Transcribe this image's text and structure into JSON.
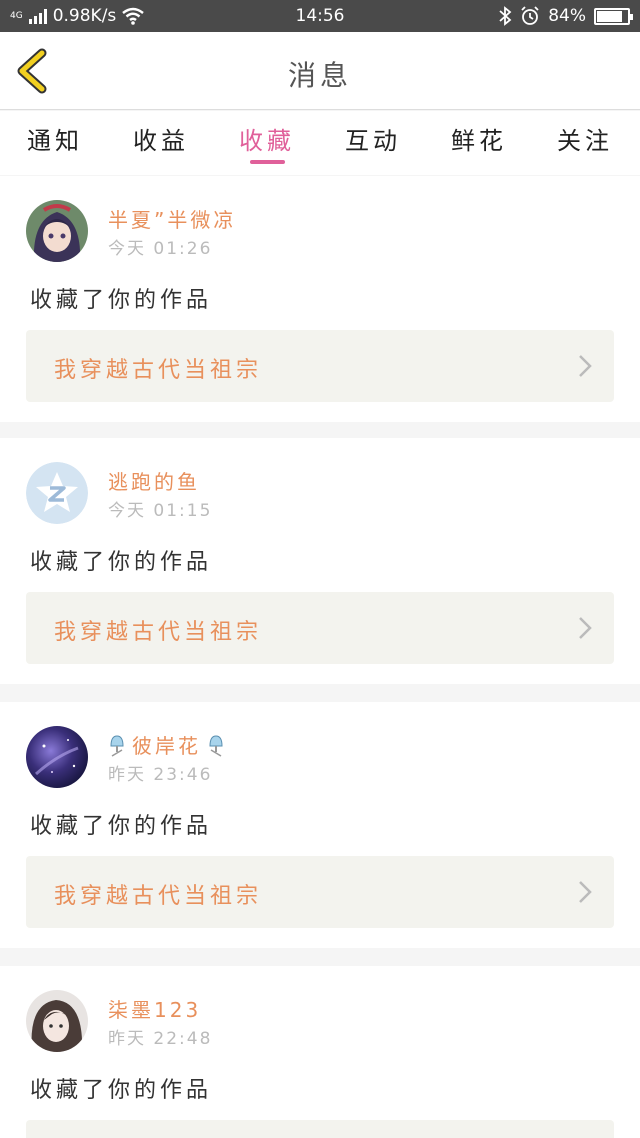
{
  "status_bar": {
    "network_type": "4G",
    "speed": "0.98K/s",
    "time": "14:56",
    "battery_text": "84%",
    "battery_level": 0.84,
    "icons": [
      "signal-icon",
      "wifi-icon",
      "bluetooth-icon",
      "alarm-icon",
      "battery-icon"
    ]
  },
  "header": {
    "title": "消息",
    "back_icon": "chevron-left-icon",
    "accent": "#f2d020"
  },
  "tabs": [
    {
      "label": "通知",
      "active": false
    },
    {
      "label": "收益",
      "active": false
    },
    {
      "label": "收藏",
      "active": true
    },
    {
      "label": "互动",
      "active": false
    },
    {
      "label": "鲜花",
      "active": false
    },
    {
      "label": "关注",
      "active": false
    }
  ],
  "colors": {
    "active_tab": "#e0609a",
    "username": "#e8905c",
    "work_title": "#e8905c",
    "work_box_bg": "#f3f3ee"
  },
  "messages": [
    {
      "username": "半夏”半微凉",
      "time": "今天 01:26",
      "action": "收藏了你的作品",
      "work_title": "我穿越古代当祖宗",
      "avatar": "anime-girl-avatar"
    },
    {
      "username": "逃跑的鱼",
      "time": "今天 01:15",
      "action": "收藏了你的作品",
      "work_title": "我穿越古代当祖宗",
      "avatar": "default-z-avatar"
    },
    {
      "username": "彼岸花",
      "time": "昨天 23:46",
      "action": "收藏了你的作品",
      "work_title": "我穿越古代当祖宗",
      "avatar": "galaxy-avatar",
      "name_decoration": "bell-icon"
    },
    {
      "username": "柒墨123",
      "time": "昨天 22:48",
      "action": "收藏了你的作品",
      "work_title": "",
      "avatar": "photo-avatar"
    }
  ]
}
